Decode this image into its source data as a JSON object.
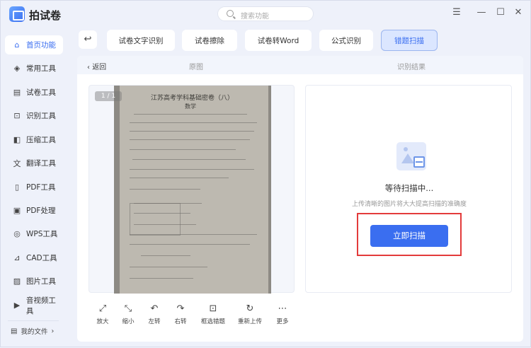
{
  "app": {
    "title": "拍试卷"
  },
  "search": {
    "placeholder": "搜索功能"
  },
  "window_controls": {
    "menu": "☰",
    "minimize": "—",
    "maximize": "☐",
    "close": "✕"
  },
  "sidebar": {
    "items": [
      {
        "label": "首页功能",
        "icon": "home-icon",
        "active": true
      },
      {
        "label": "常用工具",
        "icon": "layers-icon"
      },
      {
        "label": "试卷工具",
        "icon": "paper-icon"
      },
      {
        "label": "识别工具",
        "icon": "scan-icon"
      },
      {
        "label": "压缩工具",
        "icon": "compress-icon"
      },
      {
        "label": "翻译工具",
        "icon": "translate-icon"
      },
      {
        "label": "PDF工具",
        "icon": "pdf-icon"
      },
      {
        "label": "PDF处理",
        "icon": "pdf-process-icon"
      },
      {
        "label": "WPS工具",
        "icon": "wps-icon"
      },
      {
        "label": "CAD工具",
        "icon": "cad-icon"
      },
      {
        "label": "图片工具",
        "icon": "image-icon"
      },
      {
        "label": "音视频工具",
        "icon": "media-icon"
      }
    ],
    "my_files": "我的文件"
  },
  "toolbar": {
    "back_icon": "↩",
    "tabs": [
      {
        "label": "试卷文字识别"
      },
      {
        "label": "试卷擦除"
      },
      {
        "label": "试卷转Word"
      },
      {
        "label": "公式识别"
      },
      {
        "label": "错题扫描",
        "active": true
      }
    ]
  },
  "panel": {
    "back_label": "返回",
    "original_header": "原图",
    "result_header": "识别结果",
    "page_indicator": "1 / 1",
    "document_title": "江苏高考学科基础密卷（八）",
    "document_subtitle": "数学",
    "waiting_text": "等待扫描中...",
    "hint_text": "上传清晰的图片将大大提高扫描的准确度",
    "scan_button": "立即扫描"
  },
  "bottom_tools": [
    {
      "label": "放大",
      "icon": "zoom-in-icon"
    },
    {
      "label": "缩小",
      "icon": "zoom-out-icon"
    },
    {
      "label": "左转",
      "icon": "rotate-left-icon"
    },
    {
      "label": "右转",
      "icon": "rotate-right-icon"
    },
    {
      "label": "框选错题",
      "icon": "select-box-icon"
    },
    {
      "label": "重新上传",
      "icon": "reupload-icon"
    },
    {
      "label": "更多",
      "icon": "more-icon"
    }
  ],
  "colors": {
    "accent": "#3a6ef0",
    "highlight": "#e33b3b"
  }
}
